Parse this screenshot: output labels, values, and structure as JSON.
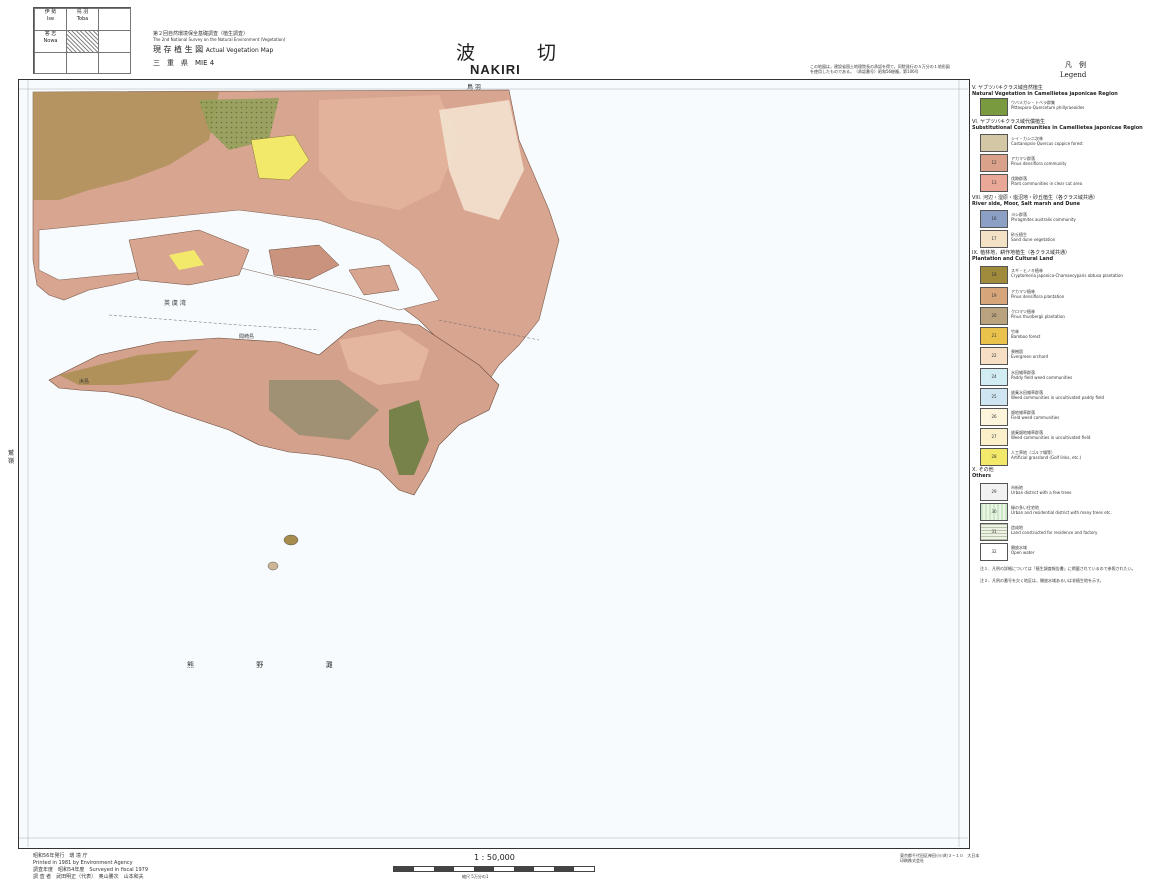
{
  "header": {
    "index": {
      "cells": [
        "伊 勢",
        "鳥 羽",
        "Ise",
        "Toba",
        "答 志",
        "Nowa",
        "",
        "",
        ""
      ]
    },
    "survey_jp": "第２回自然環境保全基礎調査（植生調査）",
    "survey_en": "The 2nd National Survey on the Natural Environment (Vegetation)",
    "map_type_jp": "現 存 植 生 図",
    "map_type_en": "Actual Vegetation Map",
    "prefecture": "三　重　県　MIE 4",
    "title_jp": "波 切",
    "title_en": "NAKIRI",
    "right_note": "この地図は，建設省国土地理院長の承認を得て，同院発行の５万分の１地形図を使用したものである。（承認番号）昭和56総複，第106号"
  },
  "map": {
    "labels": {
      "bay1": "英 虞 湾",
      "sea": "熊 野 灘",
      "isle1": "間崎島",
      "isle2": "浜島",
      "side": "鷲 嶺",
      "top_right": "鳥 羽"
    }
  },
  "legend": {
    "title_jp": "凡　例",
    "title_en": "Legend",
    "sections": [
      {
        "jp": "V. ヤブツバキクラス域自然植生",
        "en": "Natural Vegetation in Camellietea japonicae Region"
      },
      {
        "jp": "VI. ヤブツバキクラス域代償植生",
        "en": "Substitutional Communities in Camellietea japonicae Region"
      },
      {
        "jp": "VIII. 河辺・湿原・塩沼地・砂丘植生（各クラス域共通）",
        "en": "River side, Moor, Salt marsh and Dune"
      },
      {
        "jp": "IX. 植林地，耕作地植生（各クラス域共通）",
        "en": "Plantation and Cultural Land"
      },
      {
        "jp": "X. その他",
        "en": "Others"
      }
    ],
    "items": [
      {
        "code": "",
        "jp": "ウバメガシ・トベラ群集",
        "en": "Pittosporo-Quercetum phillyraeoides",
        "color": "#7a9a3f"
      },
      {
        "code": "",
        "jp": "シイ・カシ二次林",
        "en": "Castanopsis-Quercus coppice forest",
        "color": "#d4c7a6"
      },
      {
        "code": "12",
        "jp": "アカマツ群落",
        "en": "Pinus densiflora community",
        "color": "#d9a08a"
      },
      {
        "code": "13",
        "jp": "伐跡群落",
        "en": "Plant communities in clear cut area",
        "color": "#e9a898"
      },
      {
        "code": "16",
        "jp": "ヨシ群落",
        "en": "Phragmites australis community",
        "color": "#8ba0c4"
      },
      {
        "code": "17",
        "jp": "砂丘植生",
        "en": "Sand dune vegetation",
        "color": "#f4e2c6"
      },
      {
        "code": "18",
        "jp": "スギ・ヒノキ植林",
        "en": "Cryptomeria japonica-Chamaecyparis obtusa plantation",
        "color": "#a08a3c"
      },
      {
        "code": "19",
        "jp": "アカマツ植林",
        "en": "Pinus densiflora plantation",
        "color": "#d7a57a"
      },
      {
        "code": "20",
        "jp": "クロマツ植林",
        "en": "Pinus thunbergii plantation",
        "color": "#b9a27e"
      },
      {
        "code": "21",
        "jp": "竹林",
        "en": "Bamboo forest",
        "color": "#e8c24a"
      },
      {
        "code": "22",
        "jp": "果樹園",
        "en": "Evergreen orchard",
        "color": "#f6dfc4"
      },
      {
        "code": "24",
        "jp": "水田雑草群落",
        "en": "Paddy field weed communities",
        "color": "#d2ecf4"
      },
      {
        "code": "25",
        "jp": "放棄水田雑草群落",
        "en": "Weed communities in uncultivated paddy field",
        "color": "#cfe6f2"
      },
      {
        "code": "26",
        "jp": "畑地雑草群落",
        "en": "Field weed communities",
        "color": "#fdf4dc"
      },
      {
        "code": "27",
        "jp": "放棄畑地雑草群落",
        "en": "Weed communities in uncultivated field",
        "color": "#fbf0c9"
      },
      {
        "code": "28",
        "jp": "人工草地（ゴルフ場等）",
        "en": "Artificial grassland (Golf links, etc.)",
        "color": "#f2e96a"
      },
      {
        "code": "29",
        "jp": "市街地",
        "en": "Urban district with a few trees",
        "color": "#f2f2f2"
      },
      {
        "code": "30",
        "jp": "緑の多い住宅地",
        "en": "Urban and residential district with many trees etc.",
        "color": "#cde7c8"
      },
      {
        "code": "31",
        "jp": "造成地",
        "en": "Land constructed for residence and factory",
        "color": "#e8ece0"
      },
      {
        "code": "32",
        "jp": "開放水域",
        "en": "Open water",
        "color": "#ffffff"
      }
    ],
    "notes": [
      "注１．凡例の詳細については「植生調査報告書」に掲載されているので参照されたい。",
      "注２．凡例の番号を欠く地区は，開放水域あるいは非植生地を示す。"
    ]
  },
  "footer": {
    "published_jp": "昭和56年発行　環 境 庁",
    "published_en": "Printed in 1981 by Environment Agency",
    "surveyed": "調査年度　昭和54年度　Surveyed in fiscal 1979",
    "surveyors": "調 査 者　武田明正（代表）　奥山勝次　山本和夫",
    "scale": "1 : 50,000",
    "scale_note": "縮尺 5万分の1",
    "printer": "東京都千代田区神田小川町３−１０　大日本印刷株式会社"
  }
}
